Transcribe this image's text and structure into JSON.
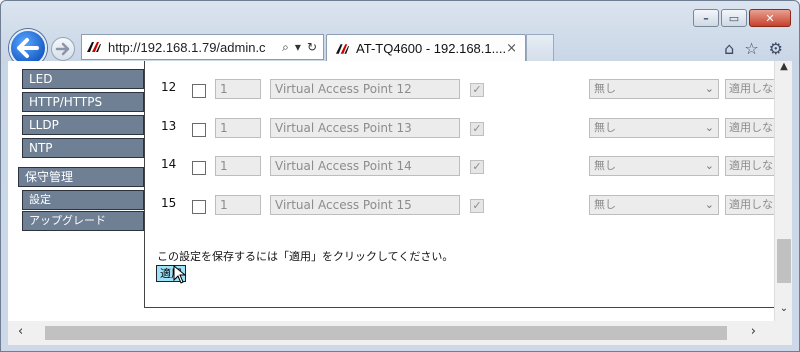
{
  "browser": {
    "url": "http://192.168.1.79/admin.c",
    "tab_title": "AT-TQ4600 - 192.168.1....",
    "tab_close": "×"
  },
  "sidebar": {
    "items": [
      {
        "label": "LED"
      },
      {
        "label": "HTTP/HTTPS"
      },
      {
        "label": "LLDP"
      },
      {
        "label": "NTP"
      }
    ],
    "section": "保守管理",
    "subitems": [
      {
        "label": "設定"
      },
      {
        "label": "アップグレード"
      }
    ]
  },
  "rows": [
    {
      "num": "12",
      "index": "1",
      "name": "Virtual Access Point 12",
      "select": "無し",
      "button": "適用しない"
    },
    {
      "num": "13",
      "index": "1",
      "name": "Virtual Access Point 13",
      "select": "無し",
      "button": "適用しない"
    },
    {
      "num": "14",
      "index": "1",
      "name": "Virtual Access Point 14",
      "select": "無し",
      "button": "適用しない"
    },
    {
      "num": "15",
      "index": "1",
      "name": "Virtual Access Point 15",
      "select": "無し",
      "button": "適用しない"
    }
  ],
  "instruction": "この設定を保存するには「適用」をクリックしてください。",
  "apply_label": "適用",
  "icons": {
    "back": "back-arrow-icon",
    "forward": "forward-arrow-icon",
    "home": "home-icon",
    "favorites": "star-icon",
    "settings": "gear-icon"
  }
}
